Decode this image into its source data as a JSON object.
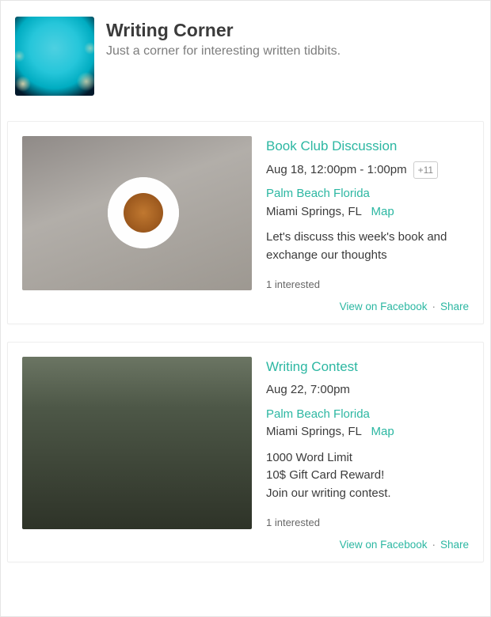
{
  "page": {
    "title": "Writing Corner",
    "tagline": "Just a corner for interesting written tidbits."
  },
  "colors": {
    "accent": "#2cb7a2",
    "text_muted": "#7d7d7d"
  },
  "events": [
    {
      "title": "Book Club Discussion",
      "datetime": "Aug 18, 12:00pm - 1:00pm",
      "more_times_badge": "+11",
      "venue": "Palm Beach Florida",
      "city": "Miami Springs, FL",
      "map_label": "Map",
      "description": "Let's discuss this week's book and exchange our thoughts",
      "interested": "1 interested",
      "view_label": "View on Facebook",
      "share_label": "Share"
    },
    {
      "title": "Writing Contest",
      "datetime": "Aug 22, 7:00pm",
      "more_times_badge": "",
      "venue": "Palm Beach Florida",
      "city": "Miami Springs, FL",
      "map_label": "Map",
      "description": "1000 Word Limit\n10$ Gift Card Reward!\nJoin our writing contest.",
      "interested": "1 interested",
      "view_label": "View on Facebook",
      "share_label": "Share"
    }
  ]
}
